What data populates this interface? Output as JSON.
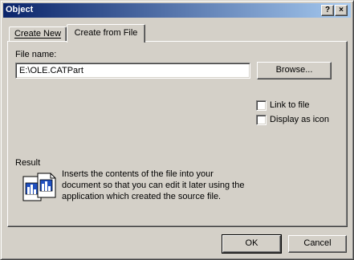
{
  "window": {
    "title": "Object",
    "help_glyph": "?",
    "close_glyph": "×"
  },
  "tabs": [
    {
      "label": "Create New"
    },
    {
      "label": "Create from File"
    }
  ],
  "form": {
    "file_name_label": "File name:",
    "file_name_value": "E:\\OLE.CATPart",
    "browse_label": "Browse...",
    "link_to_file_label": "Link to file",
    "display_as_icon_label": "Display as icon",
    "link_to_file_checked": false,
    "display_as_icon_checked": false
  },
  "result": {
    "label": "Result",
    "line1": "Inserts the contents of the file into your",
    "line2": "document so that you can edit it later using the",
    "line3": "application which created the source file.",
    "icon": "embed-document-icon"
  },
  "buttons": {
    "ok": "OK",
    "cancel": "Cancel"
  },
  "colors": {
    "face": "#d4d0c8",
    "title_start": "#0a246a",
    "title_end": "#a6caf0"
  }
}
